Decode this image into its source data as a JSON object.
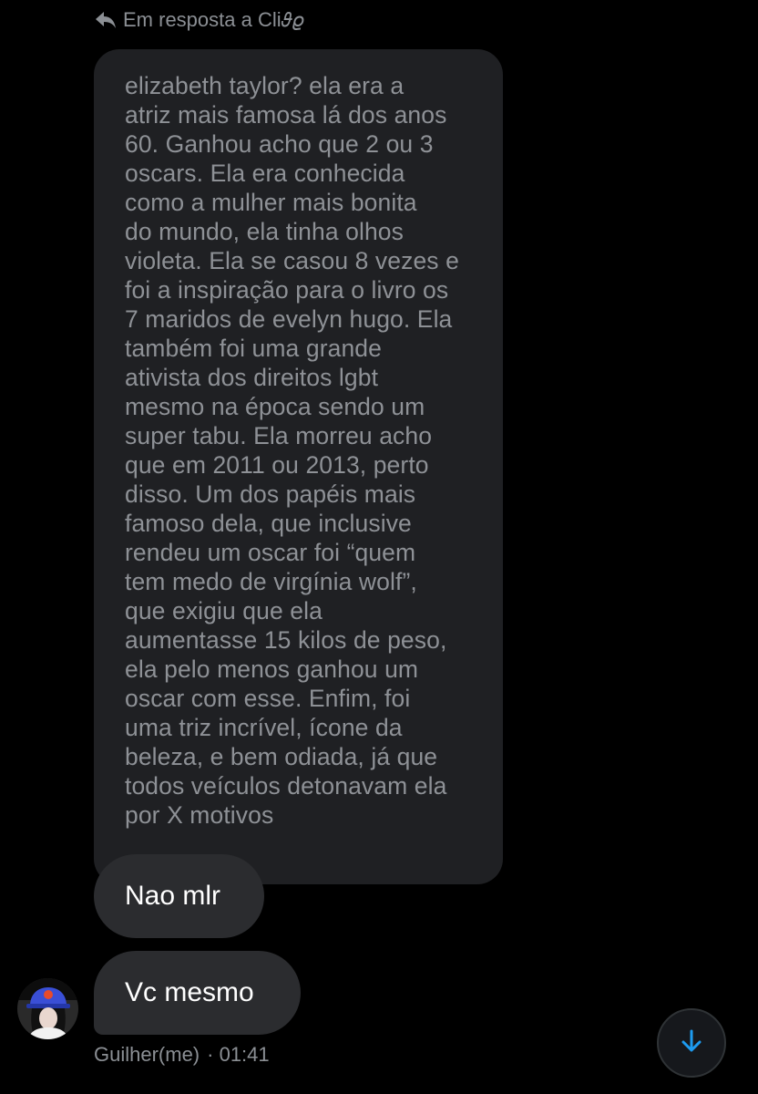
{
  "reply_header": {
    "icon": "reply-arrow-icon",
    "label": "Em resposta a Cli𝜗𝜚"
  },
  "quoted_message": {
    "text": "elizabeth taylor? ela era a\natriz mais famosa lá dos anos\n60. Ganhou acho que 2 ou 3\noscars. Ela era conhecida\ncomo a mulher mais bonita\ndo mundo, ela tinha olhos\nvioleta. Ela se casou 8 vezes e\nfoi a inspiração para o livro os\n7 maridos de evelyn hugo. Ela\ntambém foi uma grande\nativista dos direitos lgbt\nmesmo na época sendo um\nsuper tabu. Ela morreu acho\nque em 2011 ou 2013, perto\ndisso. Um dos papéis mais\nfamoso dela, que inclusive\nrendeu um oscar foi “quem\ntem medo de virgínia wolf”,\nque exigiu que ela\naumentasse 15 kilos de peso,\nela pelo menos ganhou um\noscar com esse. Enfim, foi\numa triz incrível, ícone da\nbeleza, e bem odiada, já que\ntodos veículos detonavam ela\npor X motivos"
  },
  "messages": [
    {
      "text": "Nao mlr"
    },
    {
      "text": "Vc mesmo"
    }
  ],
  "meta": {
    "sender": "Guilher(me)",
    "time": "· 01:41"
  },
  "colors": {
    "background": "#000000",
    "quoted_bubble": "#1f2023",
    "message_bubble": "#2b2c2f",
    "muted_text": "#8b8f94",
    "accent": "#1d9bf0"
  },
  "scroll_button": {
    "icon": "arrow-down-icon"
  }
}
